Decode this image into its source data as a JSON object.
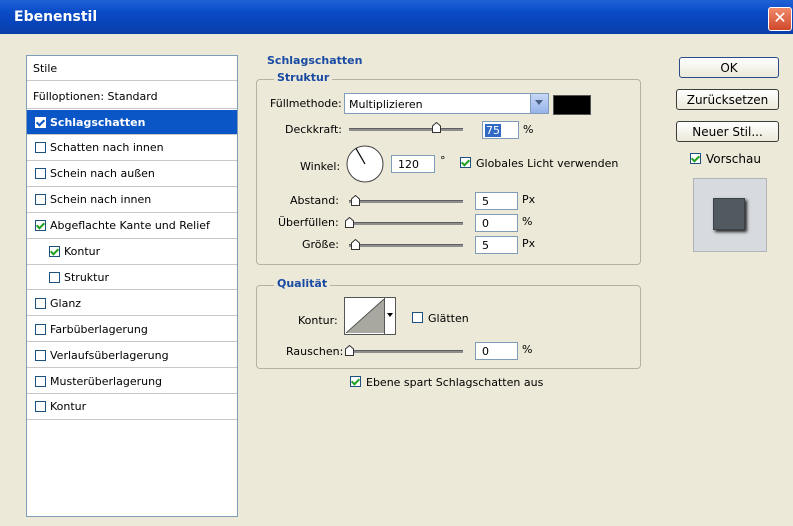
{
  "window": {
    "title": "Ebenenstil"
  },
  "styles_panel": {
    "header": "Stile",
    "blend_options": "Fülloptionen: Standard",
    "items": [
      {
        "label": "Schlagschatten",
        "checked": true,
        "selected": true
      },
      {
        "label": "Schatten nach innen",
        "checked": false
      },
      {
        "label": "Schein nach außen",
        "checked": false
      },
      {
        "label": "Schein nach innen",
        "checked": false
      },
      {
        "label": "Abgeflachte Kante und Relief",
        "checked": true
      },
      {
        "label": "Kontur",
        "checked": true,
        "sub": true
      },
      {
        "label": "Struktur",
        "checked": false,
        "sub": true
      },
      {
        "label": "Glanz",
        "checked": false
      },
      {
        "label": "Farbüberlagerung",
        "checked": false
      },
      {
        "label": "Verlaufsüberlagerung",
        "checked": false
      },
      {
        "label": "Musterüberlagerung",
        "checked": false
      },
      {
        "label": "Kontur",
        "checked": false
      }
    ]
  },
  "section": {
    "title": "Schlagschatten"
  },
  "structure": {
    "title": "Struktur",
    "blend_mode_label": "Füllmethode:",
    "blend_mode_value": "Multiplizieren",
    "shadow_color": "#000000",
    "opacity_label": "Deckkraft:",
    "opacity_value": "75",
    "opacity_unit": "%",
    "angle_label": "Winkel:",
    "angle_value": "120",
    "angle_unit": "°",
    "global_light_label": "Globales Licht verwenden",
    "global_light_checked": true,
    "distance_label": "Abstand:",
    "distance_value": "5",
    "distance_unit": "Px",
    "spread_label": "Überfüllen:",
    "spread_value": "0",
    "spread_unit": "%",
    "size_label": "Größe:",
    "size_value": "5",
    "size_unit": "Px"
  },
  "quality": {
    "title": "Qualität",
    "contour_label": "Kontur:",
    "antialias_label": "Glätten",
    "antialias_checked": false,
    "noise_label": "Rauschen:",
    "noise_value": "0",
    "noise_unit": "%",
    "knockout_label": "Ebene spart Schlagschatten aus",
    "knockout_checked": true
  },
  "buttons": {
    "ok": "OK",
    "reset": "Zurücksetzen",
    "new_style": "Neuer Stil..."
  },
  "preview": {
    "label": "Vorschau",
    "checked": true
  }
}
